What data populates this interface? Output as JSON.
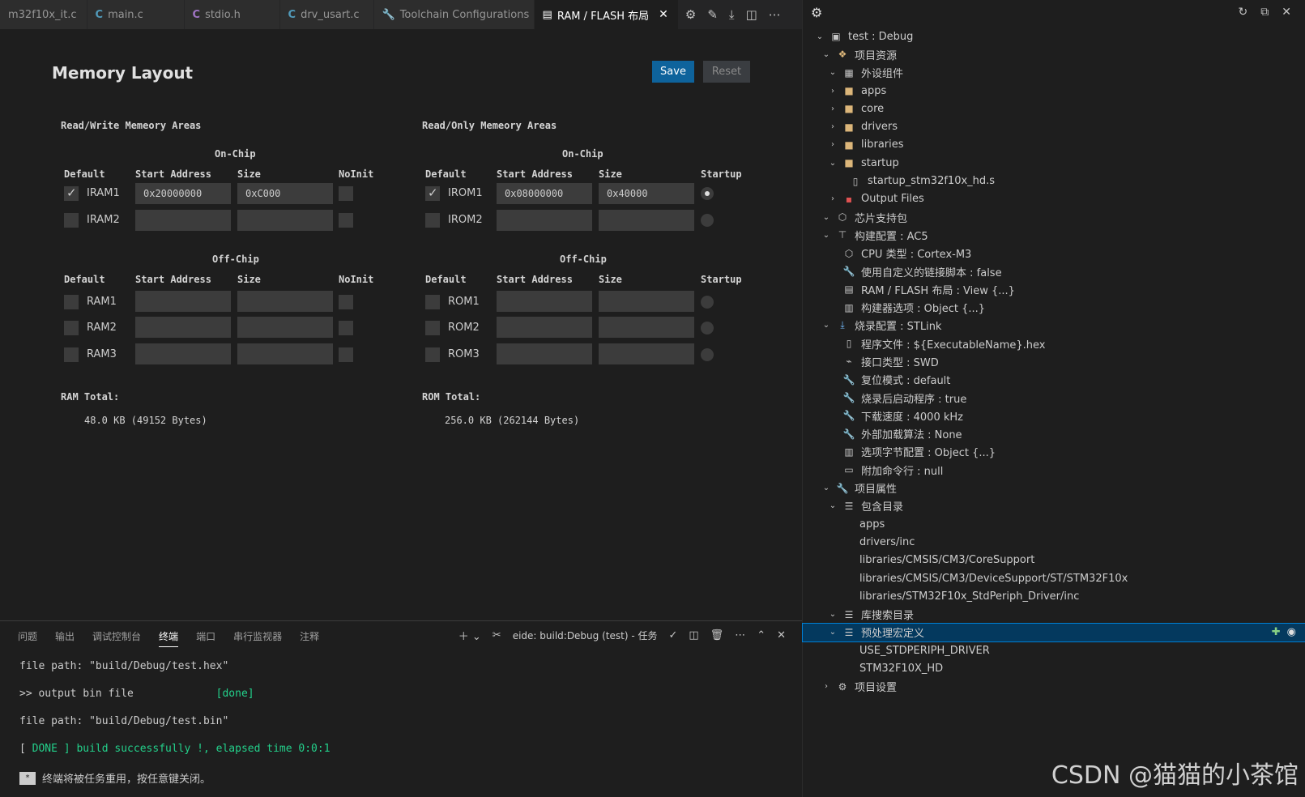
{
  "tabs": [
    {
      "icon": "",
      "label": "m32f10x_it.c",
      "active": false
    },
    {
      "icon": "C",
      "label": "main.c",
      "active": false
    },
    {
      "icon": "C",
      "label": "stdio.h",
      "active": false
    },
    {
      "icon": "C",
      "label": "drv_usart.c",
      "active": false
    },
    {
      "icon": "wrench-icon",
      "label": "Toolchain Configurations",
      "active": false
    },
    {
      "icon": "memory-icon",
      "label": "RAM / FLASH 布局",
      "active": true
    }
  ],
  "memory": {
    "title": "Memory Layout",
    "save_label": "Save",
    "reset_label": "Reset",
    "rw_title": "Read/Write Memeory Areas",
    "ro_title": "Read/Only Memeory Areas",
    "on_chip": "On-Chip",
    "off_chip": "Off-Chip",
    "col_default": "Default",
    "col_start": "Start Address",
    "col_size": "Size",
    "col_noinit": "NoInit",
    "col_startup": "Startup",
    "rw_on": [
      {
        "name": "IRAM1",
        "checked": true,
        "start": "0x20000000",
        "size": "0xC000"
      },
      {
        "name": "IRAM2",
        "checked": false,
        "start": "",
        "size": ""
      }
    ],
    "rw_off": [
      {
        "name": "RAM1",
        "checked": false,
        "start": "",
        "size": ""
      },
      {
        "name": "RAM2",
        "checked": false,
        "start": "",
        "size": ""
      },
      {
        "name": "RAM3",
        "checked": false,
        "start": "",
        "size": ""
      }
    ],
    "ro_on": [
      {
        "name": "IROM1",
        "checked": true,
        "start": "0x08000000",
        "size": "0x40000",
        "startup": true
      },
      {
        "name": "IROM2",
        "checked": false,
        "start": "",
        "size": "",
        "startup": false
      }
    ],
    "ro_off": [
      {
        "name": "ROM1",
        "checked": false,
        "start": "",
        "size": "",
        "startup": false
      },
      {
        "name": "ROM2",
        "checked": false,
        "start": "",
        "size": "",
        "startup": false
      },
      {
        "name": "ROM3",
        "checked": false,
        "start": "",
        "size": "",
        "startup": false
      }
    ],
    "ram_total_label": "RAM Total:",
    "ram_total_value": "48.0 KB (49152 Bytes)",
    "rom_total_label": "ROM Total:",
    "rom_total_value": "256.0 KB (262144 Bytes)"
  },
  "panel": {
    "tabs": [
      "问题",
      "输出",
      "调试控制台",
      "终端",
      "端口",
      "串行监视器",
      "注释"
    ],
    "active_tab": "终端",
    "task_label": "eide: build:Debug (test) - 任务",
    "lines": [
      "file path: \"build/Debug/test.hex\"",
      ">> output bin file",
      "[done]",
      "file path: \"build/Debug/test.bin\"",
      "[ ",
      "DONE",
      " ] build successfully !, elapsed time 0:0:1",
      "终端将被任务重用，按任意键关闭。"
    ]
  },
  "tree": [
    {
      "label": "test : Debug",
      "depth": 0,
      "chev": "down",
      "icon": "project-icon"
    },
    {
      "label": "项目资源",
      "depth": 1,
      "chev": "down",
      "icon": "resources-icon"
    },
    {
      "label": "外设组件",
      "depth": 2,
      "chev": "down",
      "icon": "components-icon"
    },
    {
      "label": "apps",
      "depth": 2,
      "chev": "right",
      "icon": "folder-icon"
    },
    {
      "label": "core",
      "depth": 2,
      "chev": "right",
      "icon": "folder-icon"
    },
    {
      "label": "drivers",
      "depth": 2,
      "chev": "right",
      "icon": "folder-icon"
    },
    {
      "label": "libraries",
      "depth": 2,
      "chev": "right",
      "icon": "folder-icon"
    },
    {
      "label": "startup",
      "depth": 2,
      "chev": "down",
      "icon": "folder-icon"
    },
    {
      "label": "startup_stm32f10x_hd.s",
      "depth": 3,
      "chev": "none",
      "icon": "file-icon"
    },
    {
      "label": "Output Files",
      "depth": 2,
      "chev": "right",
      "icon": "output-icon"
    },
    {
      "label": "芯片支持包",
      "depth": 1,
      "chev": "down",
      "icon": "chip-icon"
    },
    {
      "label": "构建配置 : AC5",
      "depth": 1,
      "chev": "down",
      "icon": "build-icon"
    },
    {
      "label": "CPU 类型 : Cortex-M3",
      "depth": 2,
      "chev": "none",
      "icon": "cpu-icon"
    },
    {
      "label": "使用自定义的链接脚本 : false",
      "depth": 2,
      "chev": "none",
      "icon": "wrench-icon"
    },
    {
      "label": "RAM / FLASH 布局 : View {...}",
      "depth": 2,
      "chev": "none",
      "icon": "memory-icon"
    },
    {
      "label": "构建器选项 : Object {...}",
      "depth": 2,
      "chev": "none",
      "icon": "options-icon"
    },
    {
      "label": "烧录配置 : STLink",
      "depth": 1,
      "chev": "down",
      "icon": "flash-icon"
    },
    {
      "label": "程序文件 : ${ExecutableName}.hex",
      "depth": 2,
      "chev": "none",
      "icon": "file-icon"
    },
    {
      "label": "接口类型 : SWD",
      "depth": 2,
      "chev": "none",
      "icon": "plug-icon"
    },
    {
      "label": "复位模式 : default",
      "depth": 2,
      "chev": "none",
      "icon": "wrench-icon"
    },
    {
      "label": "烧录后启动程序 : true",
      "depth": 2,
      "chev": "none",
      "icon": "wrench-icon"
    },
    {
      "label": "下载速度 : 4000 kHz",
      "depth": 2,
      "chev": "none",
      "icon": "wrench-icon"
    },
    {
      "label": "外部加载算法 : None",
      "depth": 2,
      "chev": "none",
      "icon": "wrench-icon"
    },
    {
      "label": "选项字节配置 : Object {...}",
      "depth": 2,
      "chev": "none",
      "icon": "options-icon"
    },
    {
      "label": "附加命令行 : null",
      "depth": 2,
      "chev": "none",
      "icon": "terminal-icon"
    },
    {
      "label": "项目属性",
      "depth": 1,
      "chev": "down",
      "icon": "wrench-icon"
    },
    {
      "label": "包含目录",
      "depth": 2,
      "chev": "down",
      "icon": "list-icon"
    },
    {
      "label": "apps",
      "depth": 3,
      "chev": "none",
      "icon": ""
    },
    {
      "label": "drivers/inc",
      "depth": 3,
      "chev": "none",
      "icon": ""
    },
    {
      "label": "libraries/CMSIS/CM3/CoreSupport",
      "depth": 3,
      "chev": "none",
      "icon": ""
    },
    {
      "label": "libraries/CMSIS/CM3/DeviceSupport/ST/STM32F10x",
      "depth": 3,
      "chev": "none",
      "icon": ""
    },
    {
      "label": "libraries/STM32F10x_StdPeriph_Driver/inc",
      "depth": 3,
      "chev": "none",
      "icon": ""
    },
    {
      "label": "库搜索目录",
      "depth": 2,
      "chev": "down",
      "icon": "list-icon"
    },
    {
      "label": "预处理宏定义",
      "depth": 2,
      "chev": "down",
      "icon": "list-icon",
      "selected": true
    },
    {
      "label": "USE_STDPERIPH_DRIVER",
      "depth": 3,
      "chev": "none",
      "icon": ""
    },
    {
      "label": "STM32F10X_HD",
      "depth": 3,
      "chev": "none",
      "icon": ""
    },
    {
      "label": "项目设置",
      "depth": 1,
      "chev": "right",
      "icon": "gear-icon"
    }
  ],
  "watermark": "CSDN @猫猫的小茶馆"
}
